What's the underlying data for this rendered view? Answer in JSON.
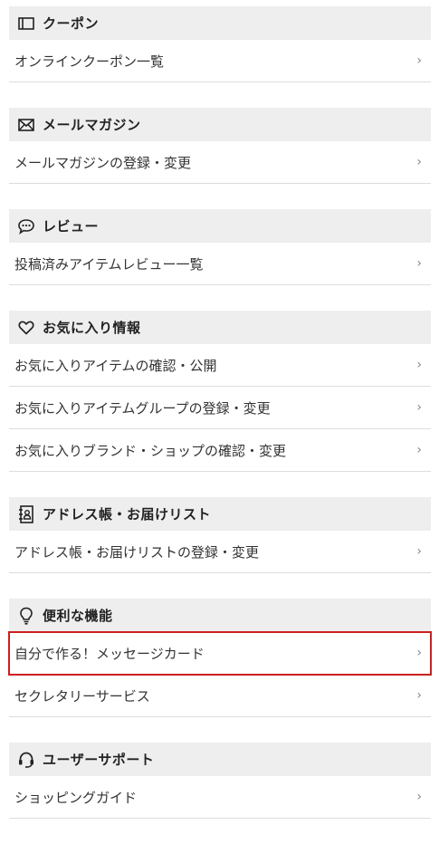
{
  "sections": [
    {
      "title": "クーポン",
      "icon": "ticket-icon",
      "items": [
        {
          "label": "オンラインクーポン一覧"
        }
      ]
    },
    {
      "title": "メールマガジン",
      "icon": "mail-icon",
      "items": [
        {
          "label": "メールマガジンの登録・変更"
        }
      ]
    },
    {
      "title": "レビュー",
      "icon": "speech-bubble-icon",
      "items": [
        {
          "label": "投稿済みアイテムレビュー一覧"
        }
      ]
    },
    {
      "title": "お気に入り情報",
      "icon": "heart-icon",
      "items": [
        {
          "label": "お気に入りアイテムの確認・公開"
        },
        {
          "label": "お気に入りアイテムグループの登録・変更"
        },
        {
          "label": "お気に入りブランド・ショップの確認・変更"
        }
      ]
    },
    {
      "title": "アドレス帳・お届けリスト",
      "icon": "address-book-icon",
      "items": [
        {
          "label": "アドレス帳・お届けリストの登録・変更"
        }
      ]
    },
    {
      "title": "便利な機能",
      "icon": "lightbulb-icon",
      "items": [
        {
          "label": "自分で作る！メッセージカード",
          "highlighted": true
        },
        {
          "label": "セクレタリーサービス"
        }
      ]
    },
    {
      "title": "ユーザーサポート",
      "icon": "headset-icon",
      "items": [
        {
          "label": "ショッピングガイド"
        }
      ]
    }
  ],
  "chevron": "›",
  "colors": {
    "header_bg": "#eeeeee",
    "divider": "#dddddd",
    "highlight_border": "#cc1f1f"
  }
}
